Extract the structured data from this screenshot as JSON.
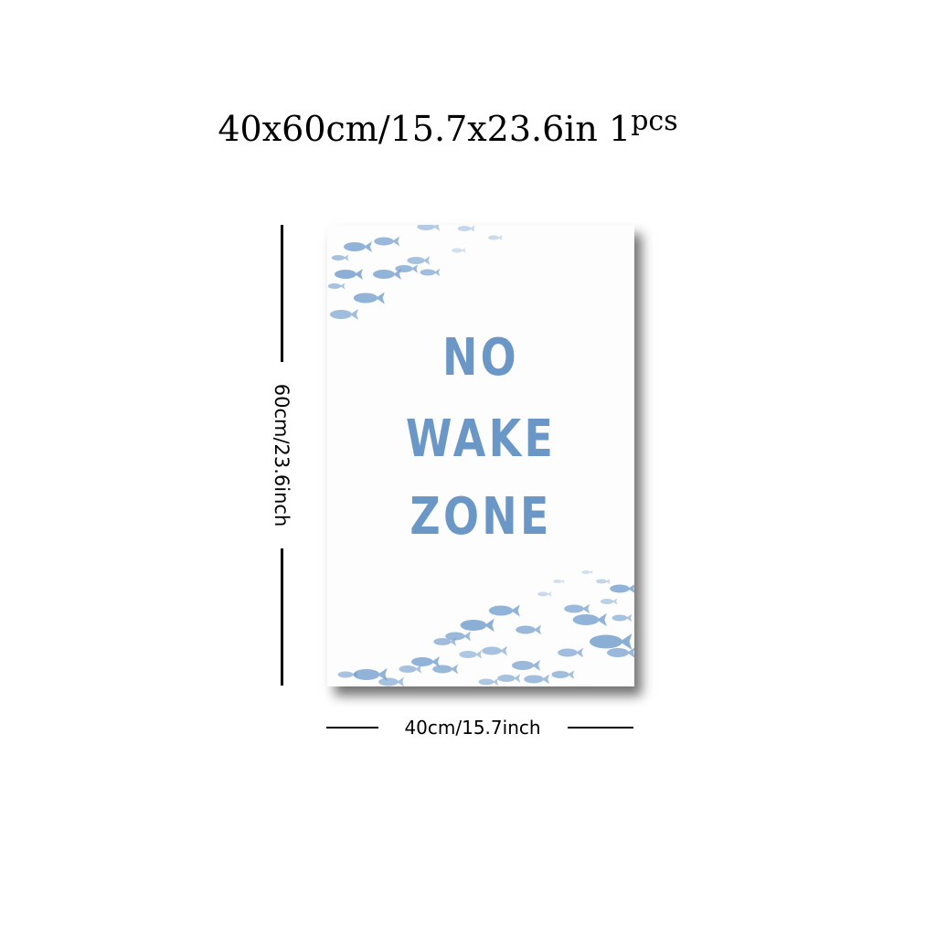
{
  "header": {
    "size_text": "40x60cm/15.7x23.6in",
    "quantity_number": "1",
    "quantity_unit": "pcs"
  },
  "dimensions": {
    "height_label": "60cm/23.6inch",
    "width_label": "40cm/15.7inch"
  },
  "poster": {
    "lines": [
      "NO",
      "WAKE",
      "ZONE"
    ],
    "text_color": "#5f8fc2",
    "fish_color": "#6f9bcc"
  }
}
